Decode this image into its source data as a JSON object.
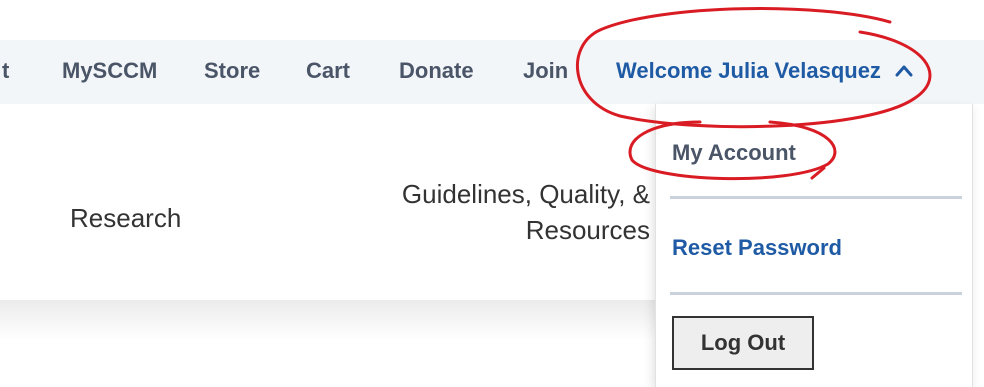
{
  "topbar": {
    "items": [
      {
        "label": "t"
      },
      {
        "label": "MySCCM"
      },
      {
        "label": "Store"
      },
      {
        "label": "Cart"
      },
      {
        "label": "Donate"
      },
      {
        "label": "Join"
      }
    ],
    "welcome": "Welcome Julia Velasquez",
    "chevron_icon": "chevron-up-icon"
  },
  "nav": {
    "research": "Research",
    "guidelines_line1": "Guidelines, Quality, &",
    "guidelines_line2": "Resources"
  },
  "dropdown": {
    "my_account": "My Account",
    "reset_password": "Reset Password",
    "log_out": "Log Out"
  },
  "colors": {
    "accent_blue": "#1f5ba5",
    "annotation_red": "#d91c24",
    "topbar_bg": "#f3f6f9"
  }
}
